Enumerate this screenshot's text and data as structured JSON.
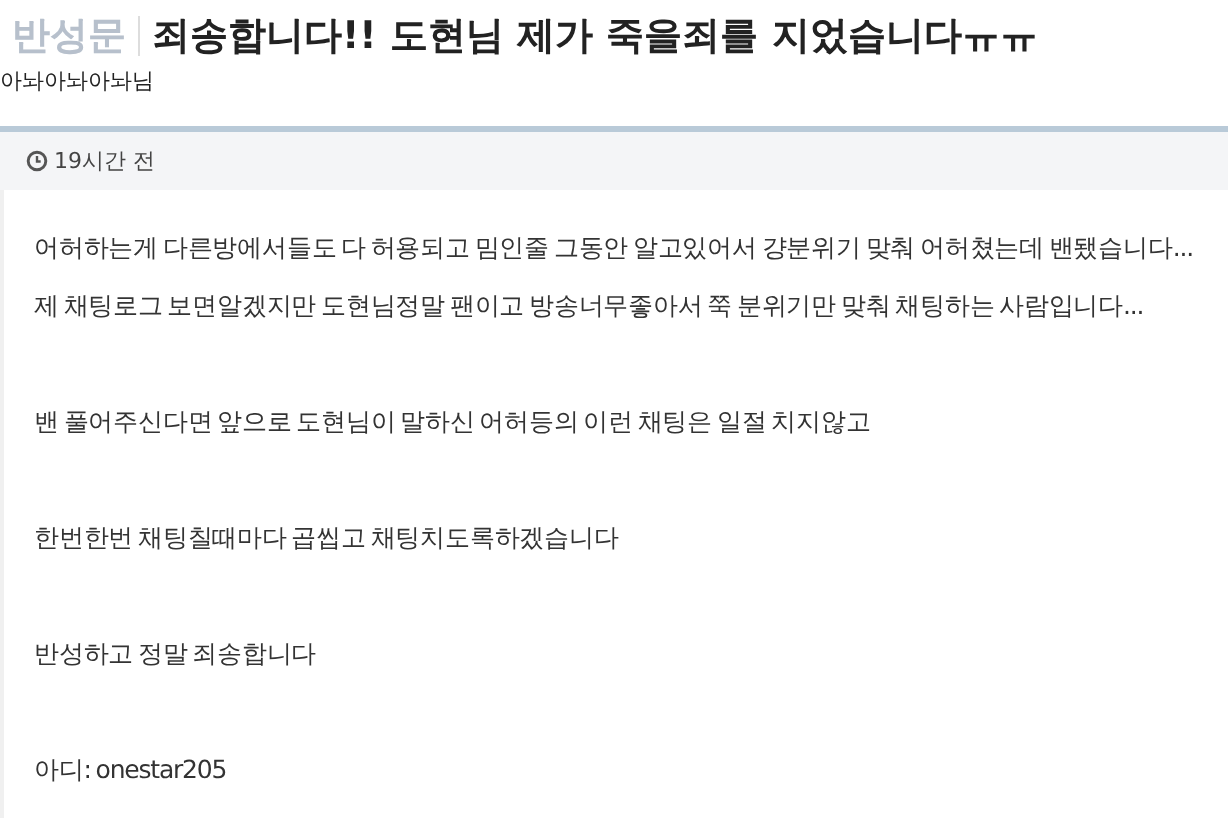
{
  "header": {
    "category": "반성문",
    "title": "죄송합니다!! 도현님 제가 죽을죄를 지었습니다ㅠㅠ",
    "author": "아놔아놔아놔님"
  },
  "meta": {
    "time": "19시간 전"
  },
  "body": [
    [
      "어허하는게 다른방에서들도 다 허용되고 밈인줄 그동안 알고있어서 걍분위기 맞춰 어허쳤는데 밴됐습니다...",
      "제 채팅로그 보면알겠지만 도현님정말 팬이고 방송너무좋아서 쭉 분위기만 맞춰 채팅하는 사람입니다..."
    ],
    [
      "밴 풀어주신다면 앞으로 도현님이 말하신 어허등의 이런 채팅은 일절 치지않고"
    ],
    [
      "한번한번 채팅칠때마다 곱씹고 채팅치도록하겠습니다"
    ],
    [
      "반성하고 정말 죄송합니다"
    ],
    [
      "아디: onestar205"
    ]
  ]
}
